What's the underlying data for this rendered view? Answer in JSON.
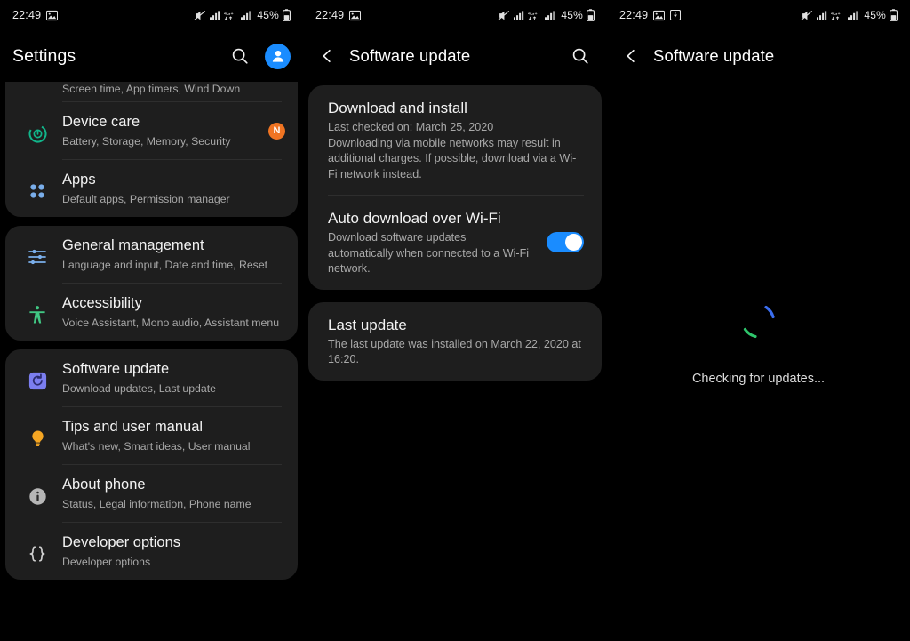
{
  "status_bar": {
    "time": "22:49",
    "battery_percent": "45%",
    "network_label": "4G+",
    "icons_left": [
      "screenshot-icon"
    ],
    "icons_left_panel3": [
      "screenshot-icon",
      "software-update-notification-icon"
    ],
    "icons_right": [
      "mute-icon",
      "signal-bars-icon",
      "network-4gplus-icon",
      "signal-bars-2-icon",
      "battery-icon"
    ]
  },
  "colors": {
    "accent_blue": "#1a8cff",
    "card_bg": "#1e1e1e",
    "screen_bg": "#000000",
    "badge_orange": "#f07422",
    "device_care_teal": "#11b58a",
    "apps_blue": "#7aaeea",
    "accessibility_green": "#41c884",
    "software_update_purple": "#7b7ef0",
    "tips_orange": "#f5a623",
    "spinner_blue": "#3b6ef0",
    "spinner_green": "#2ec46b",
    "divider": "#2e2e2e"
  },
  "panel_settings": {
    "title": "Settings",
    "actions": [
      "search-icon",
      "account-avatar"
    ],
    "scrolled_partial_subtitle": "Screen time, App timers, Wind Down",
    "groups": [
      {
        "items": [
          {
            "icon": "device-care-icon",
            "title": "Device care",
            "subtitle": "Battery, Storage, Memory, Security",
            "badge": "N"
          },
          {
            "icon": "apps-grid-icon",
            "title": "Apps",
            "subtitle": "Default apps, Permission manager",
            "badge": ""
          }
        ]
      },
      {
        "items": [
          {
            "icon": "sliders-icon",
            "title": "General management",
            "subtitle": "Language and input, Date and time, Reset",
            "badge": ""
          },
          {
            "icon": "accessibility-icon",
            "title": "Accessibility",
            "subtitle": "Voice Assistant, Mono audio, Assistant menu",
            "badge": ""
          }
        ]
      },
      {
        "items": [
          {
            "icon": "software-update-icon",
            "title": "Software update",
            "subtitle": "Download updates, Last update",
            "badge": ""
          },
          {
            "icon": "lightbulb-icon",
            "title": "Tips and user manual",
            "subtitle": "What's new, Smart ideas, User manual",
            "badge": ""
          },
          {
            "icon": "info-icon",
            "title": "About phone",
            "subtitle": "Status, Legal information, Phone name",
            "badge": ""
          },
          {
            "icon": "braces-icon",
            "title": "Developer options",
            "subtitle": "Developer options",
            "badge": ""
          }
        ]
      }
    ]
  },
  "panel_update": {
    "title": "Software update",
    "back_icon": "chevron-left-icon",
    "search_icon": "search-icon",
    "download_and_install": {
      "title": "Download and install",
      "last_checked": "Last checked on: March 25, 2020",
      "description": "Downloading via mobile networks may result in additional charges. If possible, download via a Wi-Fi network instead."
    },
    "auto_download": {
      "title": "Auto download over Wi-Fi",
      "description": "Download software updates automatically when connected to a Wi-Fi network.",
      "toggle_on": true
    },
    "last_update": {
      "title": "Last update",
      "description": "The last update was installed on March 22, 2020 at 16:20."
    }
  },
  "panel_checking": {
    "title": "Software update",
    "back_icon": "chevron-left-icon",
    "spinner_label": "Checking for updates...",
    "spinner_icon": "loading-spinner-icon"
  }
}
